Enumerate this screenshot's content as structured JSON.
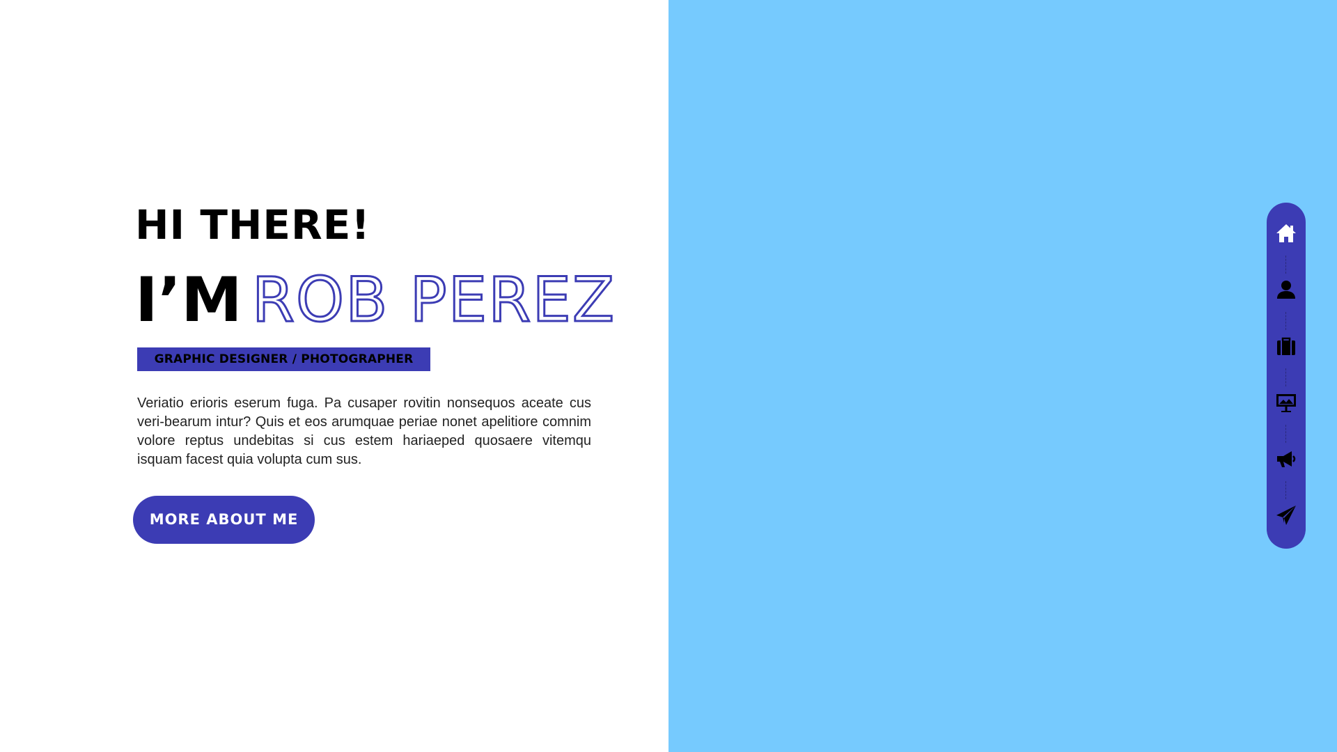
{
  "hero": {
    "greeting": "HI THERE!",
    "name_prefix": "I’M",
    "name": "ROB PEREZ",
    "role": "GRAPHIC DESIGNER / PHOTOGRAPHER",
    "bio": "Veriatio erioris eserum fuga. Pa cusaper rovitin nonsequos aceate cus veri-bearum intur? Quis et eos arumquae periae nonet apelitiore comnim volore reptus undebitas si cus estem hariaeped quosaere vitemqu isquam facest quia volupta cum sus.",
    "cta_label": "MORE ABOUT ME"
  },
  "side_nav": {
    "items": [
      {
        "icon": "home-icon"
      },
      {
        "icon": "user-icon"
      },
      {
        "icon": "briefcase-icon"
      },
      {
        "icon": "presentation-icon"
      },
      {
        "icon": "megaphone-icon"
      },
      {
        "icon": "paper-plane-icon"
      }
    ]
  },
  "colors": {
    "accent": "#3c3cb4",
    "right_panel": "#76cafe",
    "background": "#ffffff",
    "text": "#000000"
  }
}
